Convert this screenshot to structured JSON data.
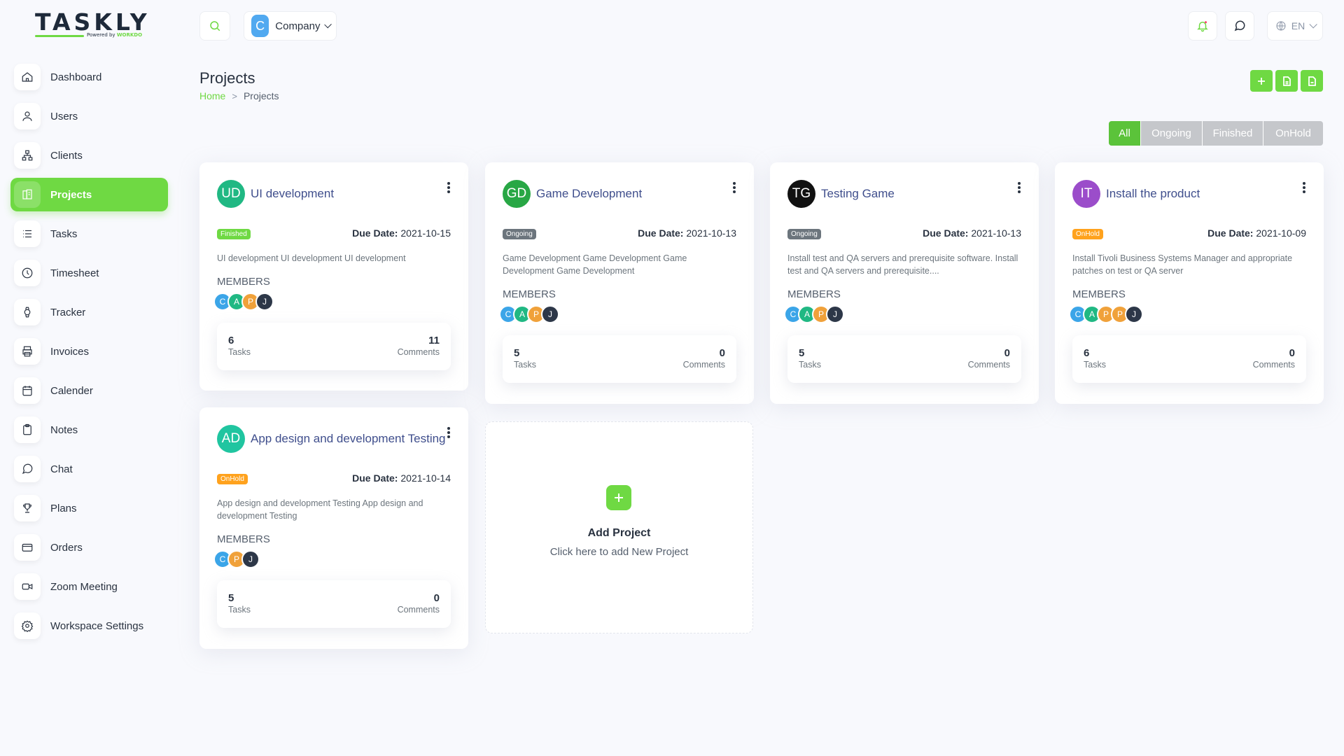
{
  "brand": {
    "logo_text": "TASKLY",
    "powered_by": "Powered by",
    "powered_brand": "WORKDO"
  },
  "header": {
    "company_initial": "C",
    "company_name": "Company",
    "language": "EN"
  },
  "sidebar": {
    "items": [
      {
        "label": "Dashboard",
        "icon": "home-icon"
      },
      {
        "label": "Users",
        "icon": "user-icon"
      },
      {
        "label": "Clients",
        "icon": "sitemap-icon"
      },
      {
        "label": "Projects",
        "icon": "building-icon",
        "active": true
      },
      {
        "label": "Tasks",
        "icon": "list-icon"
      },
      {
        "label": "Timesheet",
        "icon": "clock-icon"
      },
      {
        "label": "Tracker",
        "icon": "watch-icon"
      },
      {
        "label": "Invoices",
        "icon": "printer-icon"
      },
      {
        "label": "Calender",
        "icon": "calendar-icon"
      },
      {
        "label": "Notes",
        "icon": "clipboard-icon"
      },
      {
        "label": "Chat",
        "icon": "message-icon"
      },
      {
        "label": "Plans",
        "icon": "trophy-icon"
      },
      {
        "label": "Orders",
        "icon": "credit-card-icon"
      },
      {
        "label": "Zoom Meeting",
        "icon": "video-icon"
      },
      {
        "label": "Workspace Settings",
        "icon": "settings-icon"
      }
    ]
  },
  "page": {
    "title": "Projects",
    "breadcrumb": {
      "home": "Home",
      "sep": ">",
      "current": "Projects"
    }
  },
  "filters": {
    "all": "All",
    "ongoing": "Ongoing",
    "finished": "Finished",
    "onhold": "OnHold"
  },
  "labels": {
    "due_date": "Due Date:",
    "members": "MEMBERS",
    "tasks": "Tasks",
    "comments": "Comments"
  },
  "colors": {
    "accent": "#6fd943",
    "finished": "#6fd943",
    "ongoing": "#6c757d",
    "onhold": "#ffa21d",
    "title": "#3f4e8c"
  },
  "projects": [
    {
      "initials": "UD",
      "avatar_color": "#20b883",
      "title": "UI development",
      "status": "Finished",
      "due": "2021-10-15",
      "description": "UI development UI development UI development",
      "members": [
        {
          "i": "C",
          "c": "#3ba5e8"
        },
        {
          "i": "A",
          "c": "#20b883"
        },
        {
          "i": "P",
          "c": "#f0a13a"
        },
        {
          "i": "J",
          "c": "#2d3748"
        }
      ],
      "tasks": "6",
      "comments": "11"
    },
    {
      "initials": "GD",
      "avatar_color": "#28a745",
      "title": "Game Development",
      "status": "Ongoing",
      "due": "2021-10-13",
      "description": "Game Development Game Development Game Development Game Development",
      "members": [
        {
          "i": "C",
          "c": "#3ba5e8"
        },
        {
          "i": "A",
          "c": "#20b883"
        },
        {
          "i": "P",
          "c": "#f0a13a"
        },
        {
          "i": "J",
          "c": "#2d3748"
        }
      ],
      "tasks": "5",
      "comments": "0"
    },
    {
      "initials": "TG",
      "avatar_color": "#111111",
      "title": "Testing Game",
      "status": "Ongoing",
      "due": "2021-10-13",
      "description": "Install test and QA servers and prerequisite software. Install test and QA servers and prerequisite....",
      "members": [
        {
          "i": "C",
          "c": "#3ba5e8"
        },
        {
          "i": "A",
          "c": "#20b883"
        },
        {
          "i": "P",
          "c": "#f0a13a"
        },
        {
          "i": "J",
          "c": "#2d3748"
        }
      ],
      "tasks": "5",
      "comments": "0"
    },
    {
      "initials": "IT",
      "avatar_color": "#9b4dca",
      "title": "Install the product",
      "status": "OnHold",
      "due": "2021-10-09",
      "description": "Install Tivoli Business Systems Manager and appropriate patches on test or QA server",
      "members": [
        {
          "i": "C",
          "c": "#3ba5e8"
        },
        {
          "i": "A",
          "c": "#20b883"
        },
        {
          "i": "P",
          "c": "#f0a13a"
        },
        {
          "i": "P",
          "c": "#f0a13a"
        },
        {
          "i": "J",
          "c": "#2d3748"
        }
      ],
      "tasks": "6",
      "comments": "0"
    },
    {
      "initials": "AD",
      "avatar_color": "#20c5a0",
      "title": "App design and development Testing",
      "status": "OnHold",
      "due": "2021-10-14",
      "description": "App design and development Testing App design and development Testing",
      "members": [
        {
          "i": "C",
          "c": "#3ba5e8"
        },
        {
          "i": "P",
          "c": "#f0a13a"
        },
        {
          "i": "J",
          "c": "#2d3748"
        }
      ],
      "tasks": "5",
      "comments": "0"
    }
  ],
  "add_project": {
    "title": "Add Project",
    "subtitle": "Click here to add New Project"
  }
}
